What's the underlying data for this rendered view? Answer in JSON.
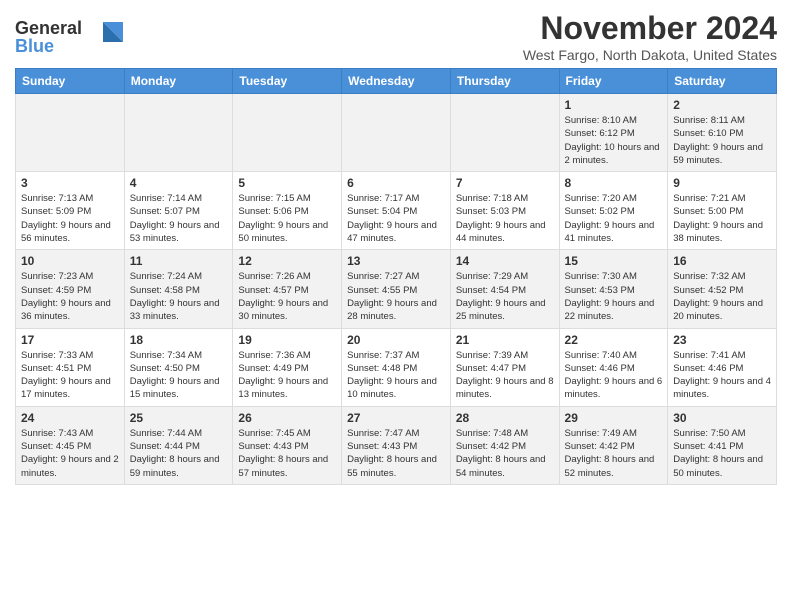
{
  "header": {
    "logo_line1": "General",
    "logo_line2": "Blue",
    "month": "November 2024",
    "location": "West Fargo, North Dakota, United States"
  },
  "days_of_week": [
    "Sunday",
    "Monday",
    "Tuesday",
    "Wednesday",
    "Thursday",
    "Friday",
    "Saturday"
  ],
  "weeks": [
    {
      "days": [
        {
          "num": "",
          "info": ""
        },
        {
          "num": "",
          "info": ""
        },
        {
          "num": "",
          "info": ""
        },
        {
          "num": "",
          "info": ""
        },
        {
          "num": "",
          "info": ""
        },
        {
          "num": "1",
          "info": "Sunrise: 8:10 AM\nSunset: 6:12 PM\nDaylight: 10 hours and 2 minutes."
        },
        {
          "num": "2",
          "info": "Sunrise: 8:11 AM\nSunset: 6:10 PM\nDaylight: 9 hours and 59 minutes."
        }
      ]
    },
    {
      "days": [
        {
          "num": "3",
          "info": "Sunrise: 7:13 AM\nSunset: 5:09 PM\nDaylight: 9 hours and 56 minutes."
        },
        {
          "num": "4",
          "info": "Sunrise: 7:14 AM\nSunset: 5:07 PM\nDaylight: 9 hours and 53 minutes."
        },
        {
          "num": "5",
          "info": "Sunrise: 7:15 AM\nSunset: 5:06 PM\nDaylight: 9 hours and 50 minutes."
        },
        {
          "num": "6",
          "info": "Sunrise: 7:17 AM\nSunset: 5:04 PM\nDaylight: 9 hours and 47 minutes."
        },
        {
          "num": "7",
          "info": "Sunrise: 7:18 AM\nSunset: 5:03 PM\nDaylight: 9 hours and 44 minutes."
        },
        {
          "num": "8",
          "info": "Sunrise: 7:20 AM\nSunset: 5:02 PM\nDaylight: 9 hours and 41 minutes."
        },
        {
          "num": "9",
          "info": "Sunrise: 7:21 AM\nSunset: 5:00 PM\nDaylight: 9 hours and 38 minutes."
        }
      ]
    },
    {
      "days": [
        {
          "num": "10",
          "info": "Sunrise: 7:23 AM\nSunset: 4:59 PM\nDaylight: 9 hours and 36 minutes."
        },
        {
          "num": "11",
          "info": "Sunrise: 7:24 AM\nSunset: 4:58 PM\nDaylight: 9 hours and 33 minutes."
        },
        {
          "num": "12",
          "info": "Sunrise: 7:26 AM\nSunset: 4:57 PM\nDaylight: 9 hours and 30 minutes."
        },
        {
          "num": "13",
          "info": "Sunrise: 7:27 AM\nSunset: 4:55 PM\nDaylight: 9 hours and 28 minutes."
        },
        {
          "num": "14",
          "info": "Sunrise: 7:29 AM\nSunset: 4:54 PM\nDaylight: 9 hours and 25 minutes."
        },
        {
          "num": "15",
          "info": "Sunrise: 7:30 AM\nSunset: 4:53 PM\nDaylight: 9 hours and 22 minutes."
        },
        {
          "num": "16",
          "info": "Sunrise: 7:32 AM\nSunset: 4:52 PM\nDaylight: 9 hours and 20 minutes."
        }
      ]
    },
    {
      "days": [
        {
          "num": "17",
          "info": "Sunrise: 7:33 AM\nSunset: 4:51 PM\nDaylight: 9 hours and 17 minutes."
        },
        {
          "num": "18",
          "info": "Sunrise: 7:34 AM\nSunset: 4:50 PM\nDaylight: 9 hours and 15 minutes."
        },
        {
          "num": "19",
          "info": "Sunrise: 7:36 AM\nSunset: 4:49 PM\nDaylight: 9 hours and 13 minutes."
        },
        {
          "num": "20",
          "info": "Sunrise: 7:37 AM\nSunset: 4:48 PM\nDaylight: 9 hours and 10 minutes."
        },
        {
          "num": "21",
          "info": "Sunrise: 7:39 AM\nSunset: 4:47 PM\nDaylight: 9 hours and 8 minutes."
        },
        {
          "num": "22",
          "info": "Sunrise: 7:40 AM\nSunset: 4:46 PM\nDaylight: 9 hours and 6 minutes."
        },
        {
          "num": "23",
          "info": "Sunrise: 7:41 AM\nSunset: 4:46 PM\nDaylight: 9 hours and 4 minutes."
        }
      ]
    },
    {
      "days": [
        {
          "num": "24",
          "info": "Sunrise: 7:43 AM\nSunset: 4:45 PM\nDaylight: 9 hours and 2 minutes."
        },
        {
          "num": "25",
          "info": "Sunrise: 7:44 AM\nSunset: 4:44 PM\nDaylight: 8 hours and 59 minutes."
        },
        {
          "num": "26",
          "info": "Sunrise: 7:45 AM\nSunset: 4:43 PM\nDaylight: 8 hours and 57 minutes."
        },
        {
          "num": "27",
          "info": "Sunrise: 7:47 AM\nSunset: 4:43 PM\nDaylight: 8 hours and 55 minutes."
        },
        {
          "num": "28",
          "info": "Sunrise: 7:48 AM\nSunset: 4:42 PM\nDaylight: 8 hours and 54 minutes."
        },
        {
          "num": "29",
          "info": "Sunrise: 7:49 AM\nSunset: 4:42 PM\nDaylight: 8 hours and 52 minutes."
        },
        {
          "num": "30",
          "info": "Sunrise: 7:50 AM\nSunset: 4:41 PM\nDaylight: 8 hours and 50 minutes."
        }
      ]
    }
  ]
}
